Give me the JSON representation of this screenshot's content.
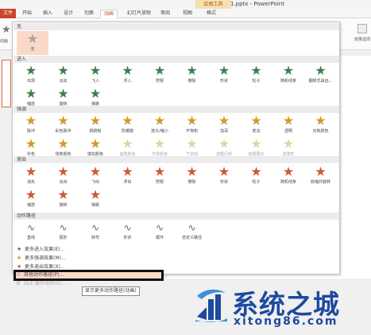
{
  "titlebar": {
    "filename": "1.pptx - PowerPoint",
    "context_tab": "绘图工具"
  },
  "tabs": [
    "文件",
    "开始",
    "插入",
    "设计",
    "切换",
    "动画",
    "幻灯片放映",
    "审阅",
    "视图",
    "格式"
  ],
  "active_tab": "动画",
  "ribbon": {
    "left_button_label": "动画",
    "right_button_label": "效果选项"
  },
  "panel": {
    "sections": {
      "none": "无",
      "entrance": "进入",
      "emphasis": "强调",
      "exit": "退出",
      "motion": "动作路径"
    },
    "none_items": [
      "无"
    ],
    "entrance_items": [
      "出现",
      "淡出",
      "飞入",
      "浮入",
      "劈裂",
      "擦除",
      "形状",
      "轮子",
      "随机线条",
      "翻转式由远...",
      "缩放",
      "旋转",
      "弹跳"
    ],
    "emphasis_items": [
      "脉冲",
      "彩色脉冲",
      "跷跷板",
      "陀螺旋",
      "放大/缩小",
      "不饱和",
      "加深",
      "变淡",
      "透明",
      "对象颜色",
      "补色",
      "线条颜色",
      "填充颜色",
      "画笔颜色",
      "字体颜色",
      "下划线",
      "加粗闪烁",
      "加粗展示",
      "波浪形"
    ],
    "exit_items": [
      "消失",
      "淡出",
      "飞出",
      "浮出",
      "劈裂",
      "擦除",
      "形状",
      "轮子",
      "随机线条",
      "收缩并旋转",
      "缩放",
      "旋转",
      "弹跳"
    ],
    "motion_items": [
      "直线",
      "弧形",
      "转弯",
      "形状",
      "循环",
      "自定义路径"
    ],
    "menu": [
      "更多进入效果(E)...",
      "更多强调效果(M)...",
      "更多退出效果(X)...",
      "其他动作路径(P)...",
      "OLE 操作动作(O)..."
    ]
  },
  "tooltip": "显示更多动作路径(动画)",
  "watermark": {
    "title": "系统之城",
    "url": "xitong86.com"
  },
  "colors": {
    "accent": "#c8452a",
    "entrance_star": "#3e7f4c",
    "emphasis_star": "#d39a28",
    "exit_star": "#d2573a",
    "watermark": "#1d4a9e",
    "highlight": "#fbd9c9"
  }
}
